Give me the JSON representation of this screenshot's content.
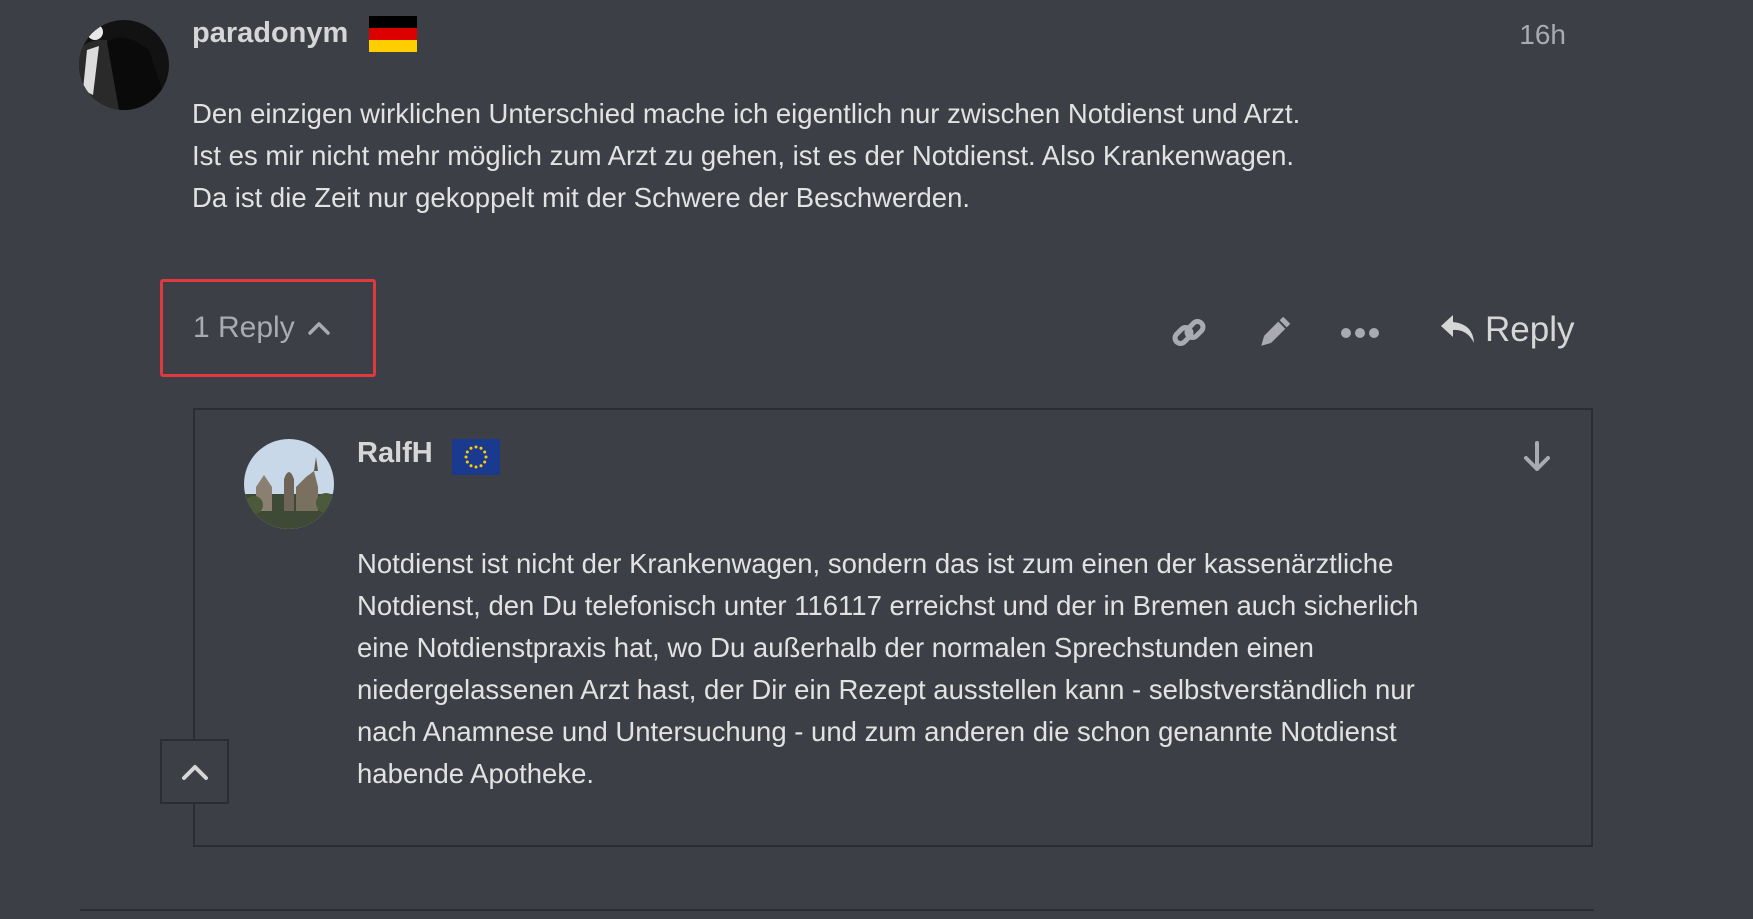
{
  "post": {
    "username": "paradonym",
    "flag_icon": "germany-flag-icon",
    "timestamp": "16h",
    "lines": [
      "Den einzigen wirklichen Unterschied mache ich eigentlich nur zwischen Notdienst und Arzt.",
      "Ist es mir nicht mehr möglich zum Arzt zu gehen, ist es der Notdienst. Also Krankenwagen.",
      "Da ist die Zeit nur gekoppelt mit der Schwere der Beschwerden."
    ]
  },
  "controls": {
    "replies_label": "1 Reply",
    "reply_label": "Reply",
    "icons": [
      "link-icon",
      "pencil-icon",
      "more-icon",
      "reply-icon",
      "chevron-up-icon"
    ]
  },
  "embedded_reply": {
    "username": "RalfH",
    "flag_icon": "eu-flag-icon",
    "lines": [
      "Notdienst ist nicht der Krankenwagen, sondern das ist zum einen der kassenärztliche",
      "Notdienst, den Du telefonisch unter 116117 erreichst und der in Bremen auch sicherlich",
      "eine Notdienstpraxis hat, wo Du außerhalb der normalen Sprechstunden einen",
      "niedergelassenen Arzt hast, der Dir ein Rezept ausstellen kann - selbstverständlich nur",
      "nach Anamnese und Untersuchung - und zum anderen die schon genannte Notdienst",
      "habende Apotheke."
    ]
  },
  "colors": {
    "background": "#3c3f46",
    "highlight_border": "#e0393d",
    "muted_text": "#a9abb0"
  }
}
